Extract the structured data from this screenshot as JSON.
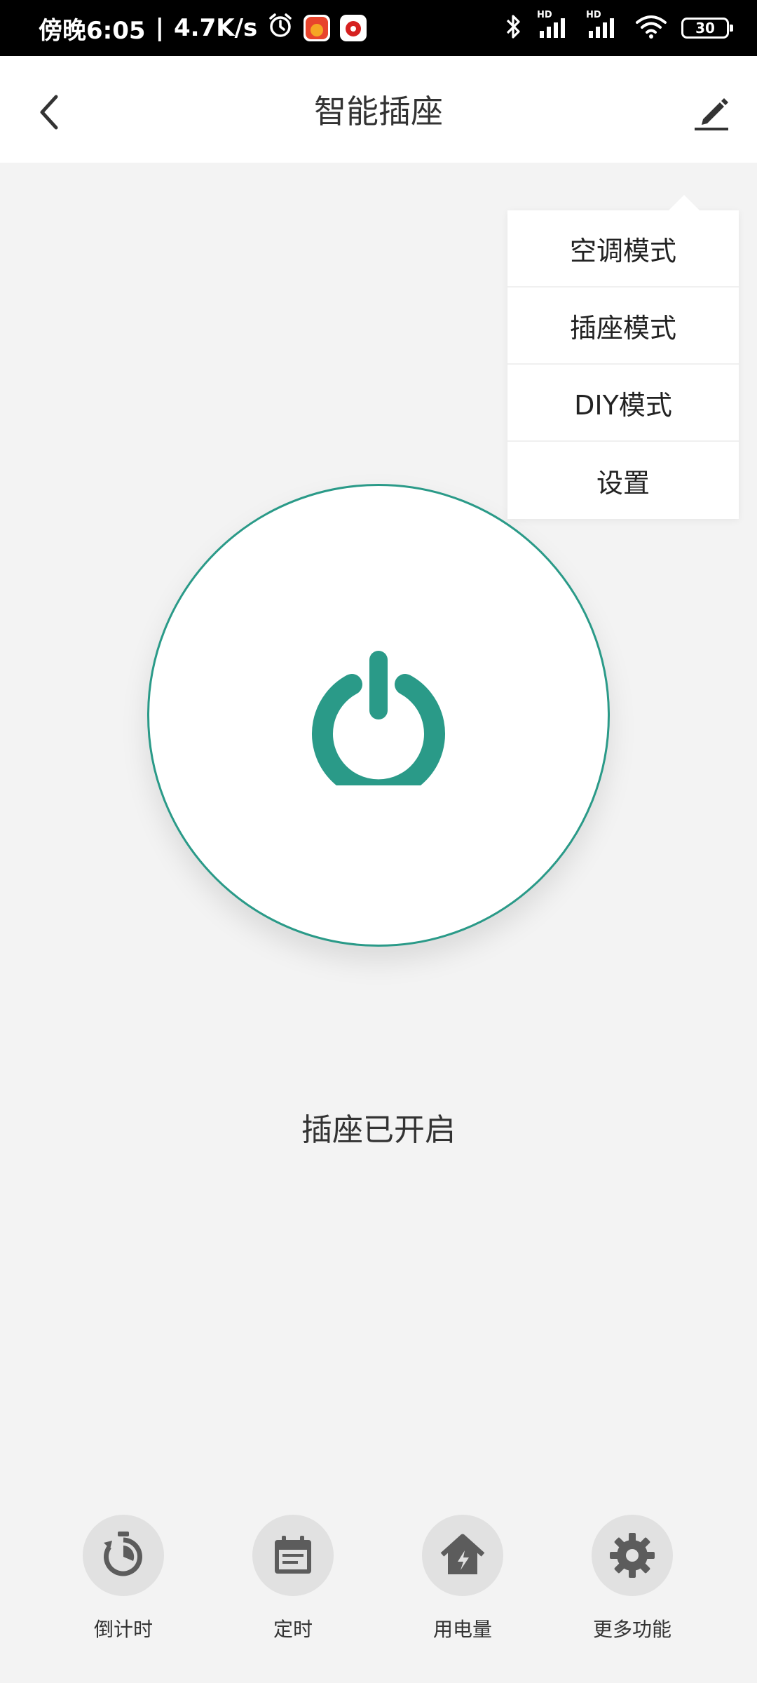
{
  "status_bar": {
    "time_text": "傍晚6:05",
    "separator": "|",
    "speed": "4.7K/s",
    "signal_tag_1": "HD",
    "signal_tag_2": "HD",
    "battery": "30"
  },
  "header": {
    "title": "智能插座"
  },
  "menu": {
    "items": [
      {
        "label": "空调模式"
      },
      {
        "label": "插座模式"
      },
      {
        "label": "DIY模式"
      },
      {
        "label": "设置"
      }
    ]
  },
  "main": {
    "status_text": "插座已开启"
  },
  "bottom_actions": [
    {
      "label": "倒计时",
      "icon": "stopwatch-icon"
    },
    {
      "label": "定时",
      "icon": "calendar-icon"
    },
    {
      "label": "用电量",
      "icon": "power-usage-icon"
    },
    {
      "label": "更多功能",
      "icon": "gear-icon"
    }
  ],
  "colors": {
    "accent": "#2a9a88",
    "icon_gray": "#5c5c5c",
    "background": "#f3f3f3"
  }
}
